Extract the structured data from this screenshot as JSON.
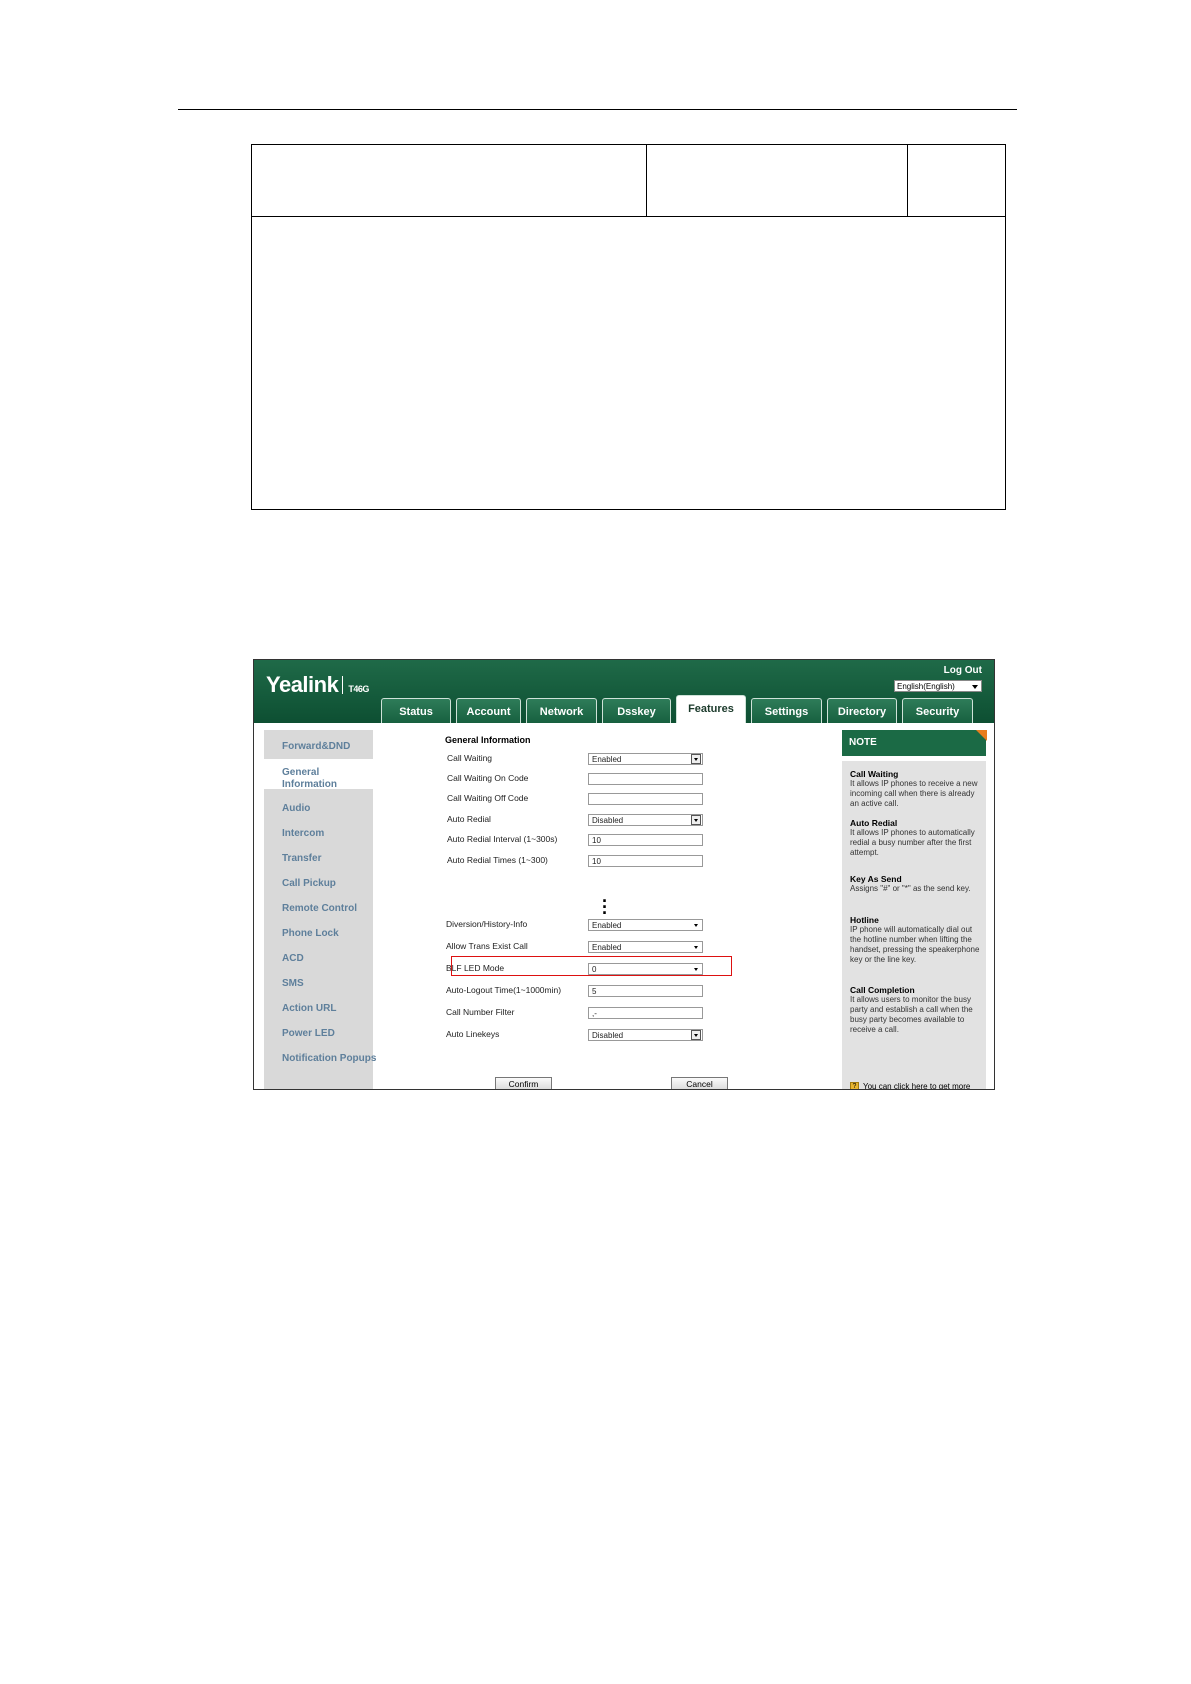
{
  "topbar": {
    "logo": "Yealink",
    "model": "T46G",
    "logout": "Log Out",
    "language": "English(English)"
  },
  "tabs": [
    "Status",
    "Account",
    "Network",
    "Dsskey",
    "Features",
    "Settings",
    "Directory",
    "Security"
  ],
  "active_tab": "Features",
  "sidebar": [
    "Forward&DND",
    "General Information",
    "Audio",
    "Intercom",
    "Transfer",
    "Call Pickup",
    "Remote Control",
    "Phone Lock",
    "ACD",
    "SMS",
    "Action URL",
    "Power LED",
    "Notification Popups"
  ],
  "sidebar_active": "General Information",
  "main": {
    "title": "General Information",
    "fields": [
      {
        "label": "Call Waiting",
        "value": "Enabled",
        "type": "select"
      },
      {
        "label": "Call Waiting On Code",
        "value": "",
        "type": "text"
      },
      {
        "label": "Call Waiting Off Code",
        "value": "",
        "type": "text"
      },
      {
        "label": "Auto Redial",
        "value": "Disabled",
        "type": "select"
      },
      {
        "label": "Auto Redial Interval (1~300s)",
        "value": "10",
        "type": "text"
      },
      {
        "label": "Auto Redial Times (1~300)",
        "value": "10",
        "type": "text"
      },
      {
        "label": "Diversion/History-Info",
        "value": "Enabled",
        "type": "select2"
      },
      {
        "label": "Allow Trans Exist Call",
        "value": "Enabled",
        "type": "select2"
      },
      {
        "label": "BLF LED Mode",
        "value": "0",
        "type": "select2"
      },
      {
        "label": "Auto-Logout Time(1~1000min)",
        "value": "5",
        "type": "text"
      },
      {
        "label": "Call Number Filter",
        "value": ",-",
        "type": "text"
      },
      {
        "label": "Auto Linekeys",
        "value": "Disabled",
        "type": "select"
      }
    ],
    "confirm": "Confirm",
    "cancel": "Cancel"
  },
  "note": {
    "heading": "NOTE",
    "items": [
      {
        "title": "Call Waiting",
        "text": "It allows IP phones to receive a new incoming call when there is already an active call."
      },
      {
        "title": "Auto Redial",
        "text": "It allows IP phones to automatically redial a busy number after the first attempt."
      },
      {
        "title": "Key As Send",
        "text": "Assigns \"#\" or \"*\" as the send key."
      },
      {
        "title": "Hotline",
        "text": "IP phone will automatically dial out the hotline number when lifting the handset, pressing the speakerphone key or the line key."
      },
      {
        "title": "Call Completion",
        "text": "It allows users to monitor the busy party and establish a call when the busy party becomes available to receive a call."
      }
    ],
    "guide": "You can click here to get more guides.",
    "guide_icon": "?"
  }
}
